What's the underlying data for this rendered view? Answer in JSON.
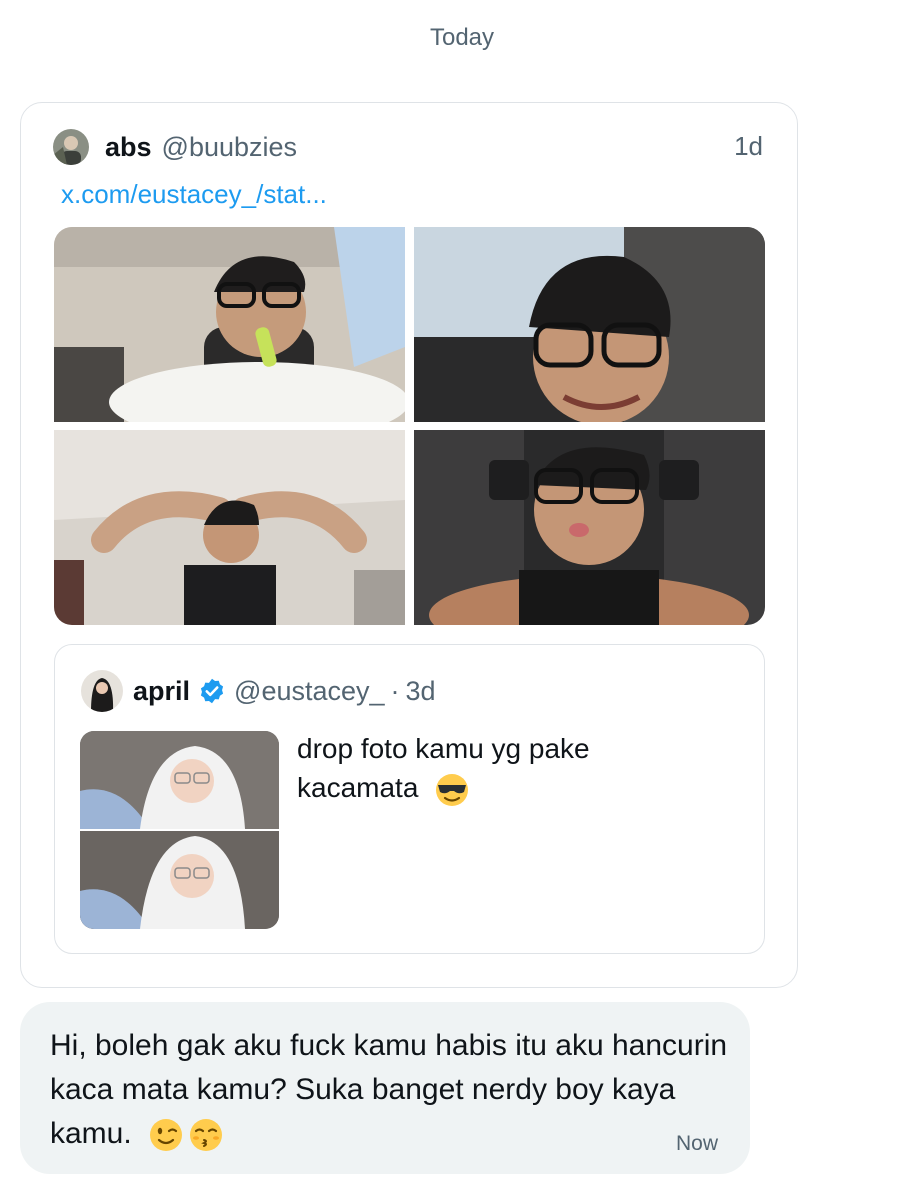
{
  "date_separator": "Today",
  "tweet": {
    "author_name": "abs",
    "author_handle": "@buubzies",
    "time": "1d",
    "link": "x.com/eustacey_/stat...",
    "media_count": 4
  },
  "quote": {
    "author_name": "april",
    "author_handle": "@eustacey_",
    "separator": "·",
    "time": "3d",
    "text": "drop foto kamu yg pake kacamata",
    "text_emoji": "smiling-face-with-sunglasses-icon"
  },
  "message": {
    "text": "Hi, boleh gak aku fuck kamu habis itu aku hancurin kaca mata kamu? Suka banget nerdy boy kaya kamu.",
    "emojis": [
      "winking-face-icon",
      "kissing-face-with-closed-eyes-icon"
    ],
    "time": "Now"
  },
  "colors": {
    "link": "#1d9bf0",
    "verified": "#1d9bf0",
    "bubble": "#eff3f4",
    "secondary_text": "#536471",
    "border": "#dfe3e7"
  }
}
